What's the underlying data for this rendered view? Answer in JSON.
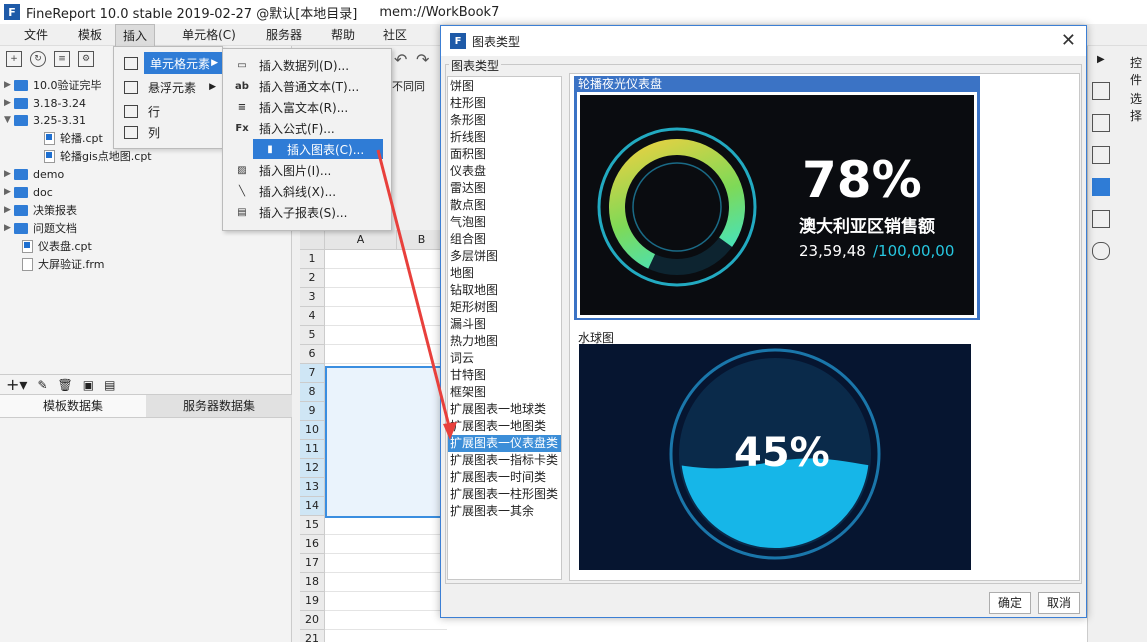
{
  "window": {
    "title": "FineReport 10.0 stable 2019-02-27 @默认[本地目录]",
    "file": "mem://WorkBook7"
  },
  "menubar": {
    "items": [
      "文件",
      "模板",
      "插入",
      "单元格(C)",
      "服务器",
      "帮助",
      "社区"
    ]
  },
  "file_tree": {
    "items": [
      {
        "label": "10.0验证完毕",
        "type": "folder"
      },
      {
        "label": "3.18-3.24",
        "type": "folder"
      },
      {
        "label": "3.25-3.31",
        "type": "folder"
      },
      {
        "label": "轮播.cpt",
        "type": "file"
      },
      {
        "label": "轮播gis点地图.cpt",
        "type": "file"
      },
      {
        "label": "demo",
        "type": "folder"
      },
      {
        "label": "doc",
        "type": "folder"
      },
      {
        "label": "决策报表",
        "type": "folder"
      },
      {
        "label": "问题文档",
        "type": "folder"
      },
      {
        "label": "仪表盘.cpt",
        "type": "file"
      },
      {
        "label": "大屏验证.frm",
        "type": "file"
      }
    ]
  },
  "dataset_tabs": {
    "template": "模板数据集",
    "server": "服务器数据集"
  },
  "insert_menu": {
    "items": [
      "单元格元素",
      "悬浮元素",
      "行",
      "列"
    ]
  },
  "cell_element_menu": {
    "items": [
      "插入数据列(D)...",
      "插入普通文本(T)...",
      "插入富文本(R)...",
      "插入公式(F)...",
      "插入图表(C)...",
      "插入图片(I)...",
      "插入斜线(X)...",
      "插入子报表(S)..."
    ],
    "icons": [
      "data-column-icon",
      "text-icon",
      "rich-text-icon",
      "formula-icon",
      "chart-icon",
      "image-icon",
      "slash-icon",
      "sub-report-icon"
    ],
    "icon_glyphs": [
      "▭",
      "ab",
      "≡",
      "Fx",
      "▮",
      "▨",
      "╲",
      "▤"
    ]
  },
  "toolbar_partial": {
    "text": "不同同"
  },
  "sheet": {
    "columns": [
      "A",
      "B"
    ],
    "rows": [
      "1",
      "2",
      "3",
      "4",
      "5",
      "6",
      "7",
      "8",
      "9",
      "10",
      "11",
      "12",
      "13",
      "14",
      "15",
      "16",
      "17",
      "18",
      "19",
      "20",
      "21"
    ]
  },
  "right_panel": {
    "label1": "控件",
    "label2": "选择"
  },
  "dialog": {
    "title": "图表类型",
    "group_label": "图表类型",
    "chart_types": [
      "饼图",
      "柱形图",
      "条形图",
      "折线图",
      "面积图",
      "仪表盘",
      "雷达图",
      "散点图",
      "气泡图",
      "组合图",
      "多层饼图",
      "地图",
      "钻取地图",
      "矩形树图",
      "漏斗图",
      "热力地图",
      "词云",
      "甘特图",
      "框架图",
      "扩展图表一地球类",
      "扩展图表一地图类",
      "扩展图表一仪表盘类",
      "扩展图表一指标卡类",
      "扩展图表一时间类",
      "扩展图表一柱形图类",
      "扩展图表一其余"
    ],
    "selected_index": 21,
    "previews": [
      {
        "title": "轮播夜光仪表盘",
        "value": "78%",
        "label": "澳大利亚区销售额",
        "current": "23,59,48",
        "target": "/100,00,00",
        "progress": 0.78
      },
      {
        "title": "水球图",
        "value": "45%",
        "progress": 0.45
      }
    ],
    "ok": "确定",
    "cancel": "取消"
  },
  "colors": {
    "accent": "#2f7cd6",
    "gauge_bg": "#0a0c10",
    "gauge_ring": "#27c7e0",
    "liquid": "#16b6e8",
    "arrow": "#e8403c"
  }
}
